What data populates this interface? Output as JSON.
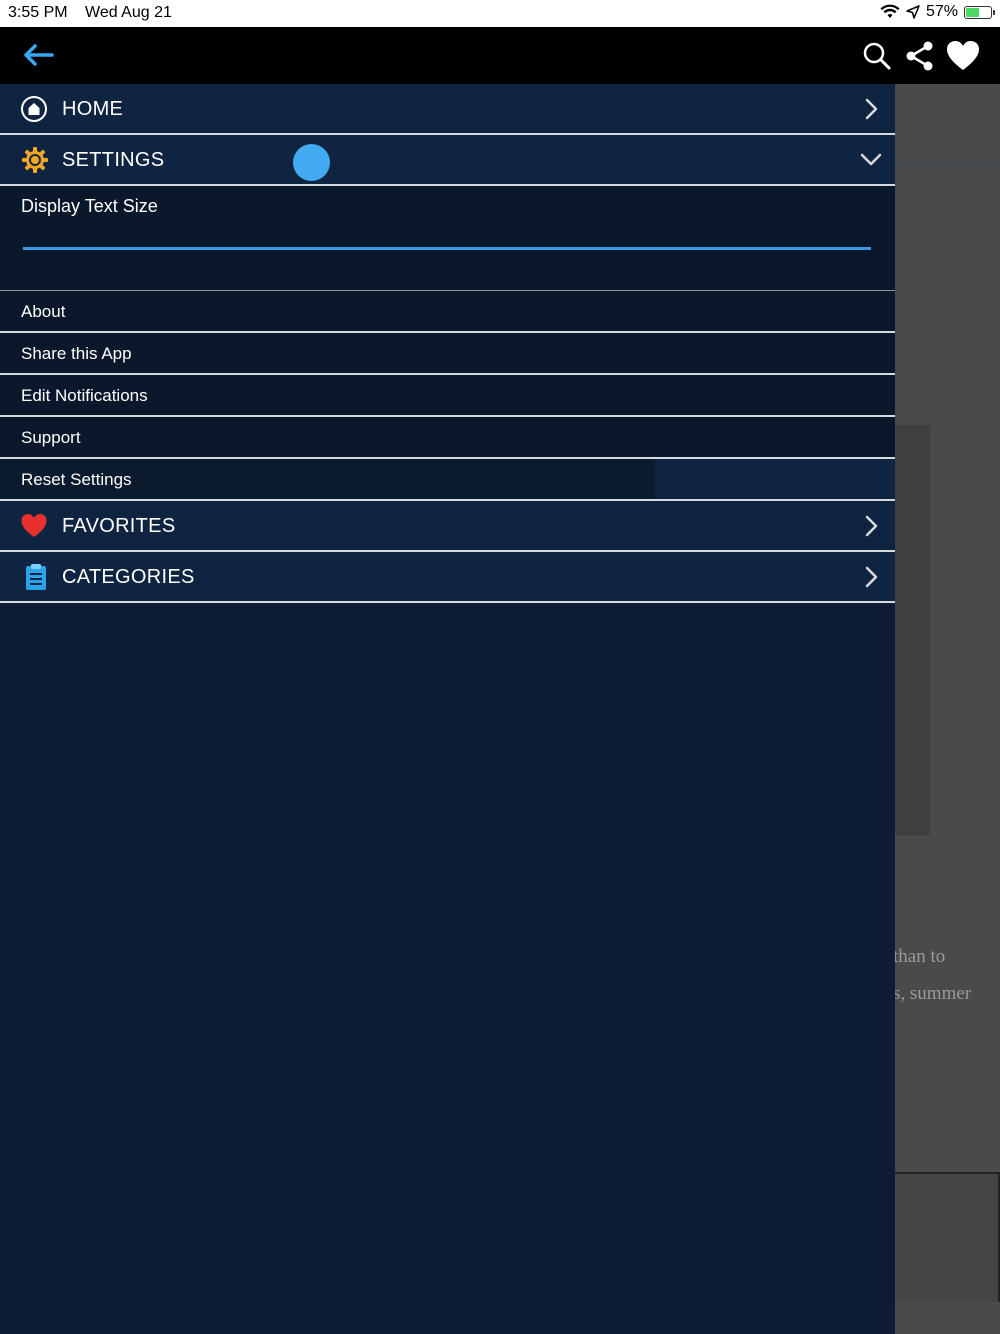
{
  "status_bar": {
    "time": "3:55 PM",
    "date": "Wed Aug 21",
    "battery": "57%",
    "battery_level": 0.57
  },
  "topbar": {
    "back_icon": "arrow-left-icon",
    "actions": [
      "search-icon",
      "share-icon",
      "heart-icon"
    ]
  },
  "drawer": {
    "home": {
      "label": "HOME",
      "icon": "home-icon"
    },
    "settings": {
      "label": "SETTINGS",
      "icon": "gear-icon",
      "text_size_label": "Display Text Size",
      "text_size_value": 0.34,
      "items": [
        "About",
        "Share this App",
        "Edit Notifications",
        "Support",
        "Reset Settings"
      ]
    },
    "favorites": {
      "label": "FAVORITES",
      "icon": "heart-icon"
    },
    "categories": {
      "label": "CATEGORIES",
      "icon": "clipboard-icon"
    }
  },
  "background": {
    "snippet_1": "than to",
    "snippet_2": "s, summer"
  },
  "colors": {
    "accent": "#42aaf0",
    "drawer_bg": "#0e1d35",
    "gear": "#f5a623",
    "heart": "#e8302e"
  }
}
